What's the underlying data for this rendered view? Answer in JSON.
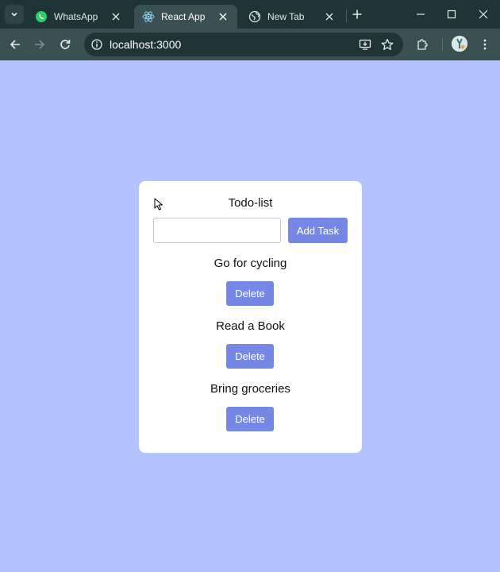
{
  "browser": {
    "tabs": [
      {
        "label": "WhatsApp",
        "icon": "whatsapp-icon",
        "active": false
      },
      {
        "label": "React App",
        "icon": "react-icon",
        "active": true
      },
      {
        "label": "New Tab",
        "icon": "globe-icon",
        "active": false
      }
    ],
    "address": "localhost:3000"
  },
  "app": {
    "title": "Todo-list",
    "input_value": "",
    "add_label": "Add Task",
    "delete_label": "Delete",
    "tasks": [
      "Go for cycling",
      "Read a Book",
      "Bring groceries"
    ]
  },
  "colors": {
    "page_background": "#b2c3ff",
    "button": "#7588e6",
    "card": "#ffffff"
  }
}
